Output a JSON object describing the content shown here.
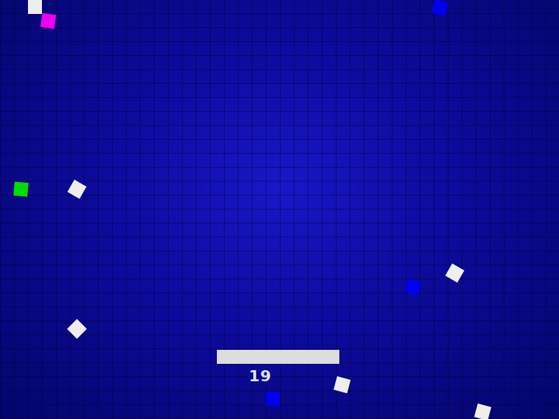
{
  "score": "19",
  "blocks": [
    {
      "color": "#eeeeee"
    },
    {
      "color": "#ee00ee"
    },
    {
      "color": "#0000ee"
    },
    {
      "color": "#00dd00"
    },
    {
      "color": "#eeeeee"
    },
    {
      "color": "#eeeeee"
    },
    {
      "color": "#0000ee"
    },
    {
      "color": "#eeeeee"
    },
    {
      "color": "#eeeeee"
    },
    {
      "color": "#0000ee"
    },
    {
      "color": "#eeeeee"
    }
  ]
}
